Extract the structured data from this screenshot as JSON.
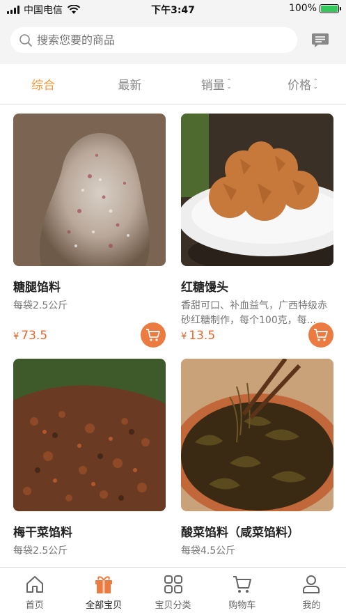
{
  "status_bar": {
    "carrier": "中国电信",
    "time": "下午3:47",
    "battery": "100%"
  },
  "search": {
    "placeholder": "搜索您要的商品"
  },
  "sort_tabs": [
    {
      "label": "综合",
      "active": true
    },
    {
      "label": "最新",
      "active": false
    },
    {
      "label": "销量",
      "active": false
    },
    {
      "label": "价格",
      "active": false
    }
  ],
  "products": [
    {
      "title": "糖腿馅料",
      "desc": "每袋2.5公斤",
      "currency": "¥",
      "price": "73.5",
      "image": "ham-filling-photo"
    },
    {
      "title": "红糖馒头",
      "desc": "香甜可口、补血益气，广西特级赤砂红糖制作，每个100克，每...",
      "currency": "¥",
      "price": "13.5",
      "image": "brown-sugar-bun-photo"
    },
    {
      "title": "梅干菜馅料",
      "desc": "每袋2.5公斤",
      "image": "dried-vegetable-filling-photo"
    },
    {
      "title": "酸菜馅料（咸菜馅料）",
      "desc": "每袋4.5公斤",
      "image": "pickled-vegetable-filling-photo"
    }
  ],
  "tabbar": [
    {
      "label": "首页",
      "icon": "home-icon",
      "active": false
    },
    {
      "label": "全部宝贝",
      "icon": "gift-icon",
      "active": true
    },
    {
      "label": "宝贝分类",
      "icon": "grid-icon",
      "active": false
    },
    {
      "label": "购物车",
      "icon": "cart-icon",
      "active": false
    },
    {
      "label": "我的",
      "icon": "user-icon",
      "active": false
    }
  ],
  "colors": {
    "accent": "#f29a3c",
    "price": "#e8672f",
    "cart_button": "#eb7b41"
  }
}
